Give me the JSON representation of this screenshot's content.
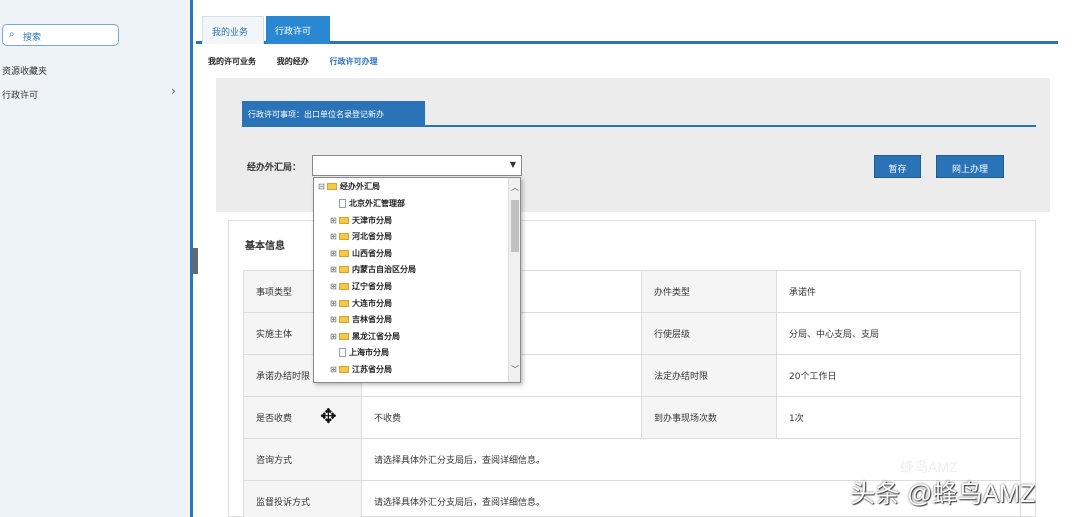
{
  "sidebar": {
    "search_label": "搜索",
    "items": [
      {
        "label": "资源收藏夹"
      },
      {
        "label": "行政许可"
      }
    ],
    "arrow": "›"
  },
  "top_tabs": [
    {
      "label": "我的业务"
    },
    {
      "label": "行政许可"
    }
  ],
  "breadcrumb": [
    "我的许可业务",
    "我的经办",
    "行政许可办理"
  ],
  "panel": {
    "tab_label": "行政许可事项：出口单位名录登记新办",
    "field_label": "经办外汇局：",
    "select_value": "",
    "btn_save": "暂存",
    "btn_online": "网上办理"
  },
  "tree": {
    "root": "经办外汇局",
    "nodes": [
      {
        "label": "北京外汇管理部",
        "expandable": false
      },
      {
        "label": "天津市分局",
        "expandable": true
      },
      {
        "label": "河北省分局",
        "expandable": true
      },
      {
        "label": "山西省分局",
        "expandable": true
      },
      {
        "label": "内蒙古自治区分局",
        "expandable": true
      },
      {
        "label": "辽宁省分局",
        "expandable": true
      },
      {
        "label": "大连市分局",
        "expandable": true
      },
      {
        "label": "吉林省分局",
        "expandable": true
      },
      {
        "label": "黑龙江省分局",
        "expandable": true
      },
      {
        "label": "上海市分局",
        "expandable": false
      },
      {
        "label": "江苏省分局",
        "expandable": true
      }
    ]
  },
  "info": {
    "title": "基本信息",
    "rows": [
      {
        "l1": "事项类型",
        "v1": "",
        "l2": "办件类型",
        "v2": "承诺件"
      },
      {
        "l1": "实施主体",
        "v1": "",
        "l2": "行使层级",
        "v2": "分局、中心支局、支局"
      },
      {
        "l1": "承诺办结时限",
        "v1": "",
        "l2": "法定办结时限",
        "v2": "20个工作日"
      },
      {
        "l1": "是否收费",
        "v1": "不收费",
        "l2": "到办事现场次数",
        "v2": "1次"
      },
      {
        "l1": "咨询方式",
        "v1": "请选择具体外汇分支局后，查阅详细信息。"
      },
      {
        "l1": "监督投诉方式",
        "v1": "请选择具体外汇分支局后，查阅详细信息。"
      }
    ]
  },
  "watermark": {
    "sub": "蜂鸟AMZ",
    "main": "头条 @蜂鸟AMZ"
  },
  "colors": {
    "accent": "#2a73b7",
    "tab_active": "#2a88d2",
    "panel_bg": "#ececec"
  }
}
